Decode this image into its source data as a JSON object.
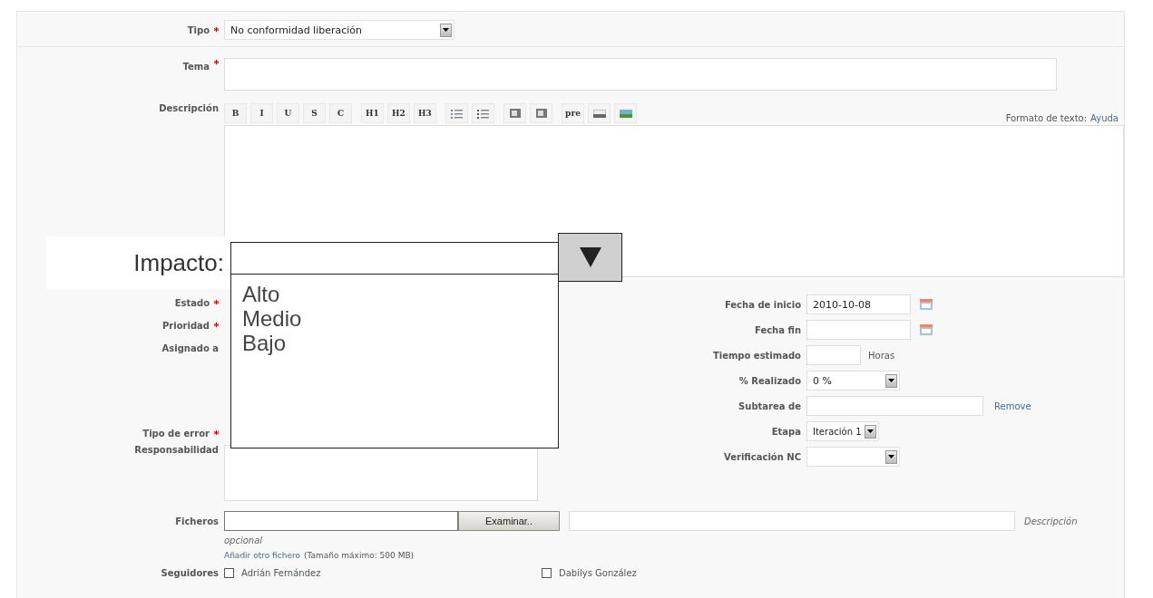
{
  "tipo": {
    "label": "Tipo",
    "required": true,
    "value": "No conformidad liberación"
  },
  "tema": {
    "label": "Tema",
    "required": true
  },
  "descripcion": {
    "label": "Descripción",
    "help_text": "Formato de texto:",
    "help_link": "Ayuda",
    "toolbar": [
      {
        "kind": "text",
        "label": "B"
      },
      {
        "kind": "text",
        "label": "I"
      },
      {
        "kind": "text",
        "label": "U"
      },
      {
        "kind": "text",
        "label": "S"
      },
      {
        "kind": "text",
        "label": "C"
      },
      {
        "kind": "text",
        "label": "H1"
      },
      {
        "kind": "text",
        "label": "H2"
      },
      {
        "kind": "text",
        "label": "H3"
      },
      {
        "kind": "list"
      },
      {
        "kind": "numbered-list"
      },
      {
        "kind": "block"
      },
      {
        "kind": "block"
      },
      {
        "kind": "text",
        "label": "pre"
      },
      {
        "kind": "image"
      },
      {
        "kind": "landscape"
      }
    ]
  },
  "left_top": [
    {
      "label": "Estado",
      "required": true
    },
    {
      "label": "Prioridad",
      "required": true
    },
    {
      "label": "Asignado a",
      "required": false
    }
  ],
  "left_bottom": [
    {
      "label": "Tipo de error",
      "required": true,
      "kind": "none"
    },
    {
      "label": "Responsabilidad",
      "required": false,
      "kind": "textarea"
    }
  ],
  "right_fields": [
    {
      "label": "Fecha de inicio",
      "kind": "date",
      "value": "2010-10-08"
    },
    {
      "label": "Fecha fin",
      "kind": "date"
    },
    {
      "label": "Tiempo estimado",
      "kind": "hours",
      "suffix": "Horas"
    },
    {
      "label": "% Realizado",
      "kind": "select",
      "value": "0 %"
    },
    {
      "label": "Subtarea de",
      "kind": "link",
      "link": "Remove"
    },
    {
      "label": "Etapa",
      "kind": "select-small",
      "value": "Iteración 1"
    },
    {
      "label": "Verificación NC",
      "kind": "select"
    }
  ],
  "ficheros": {
    "label": "Ficheros",
    "button": "Examinar..",
    "description_hint": "Descripción",
    "optional": "opcional",
    "add_link": "Añadir otro fichero",
    "max_size": "(Tamaño máximo: 500 MB)"
  },
  "seguidores": {
    "label": "Seguidores",
    "people": [
      {
        "name": "Adrián Fernández",
        "checked": false
      },
      {
        "name": "Dabilys González",
        "checked": false
      }
    ]
  },
  "impacto": {
    "label": "Impacto:",
    "expanded": true,
    "options": [
      {
        "label": "Alto",
        "selected": false
      },
      {
        "label": "Medio",
        "selected": false
      },
      {
        "label": "Bajo",
        "selected": false
      }
    ]
  }
}
